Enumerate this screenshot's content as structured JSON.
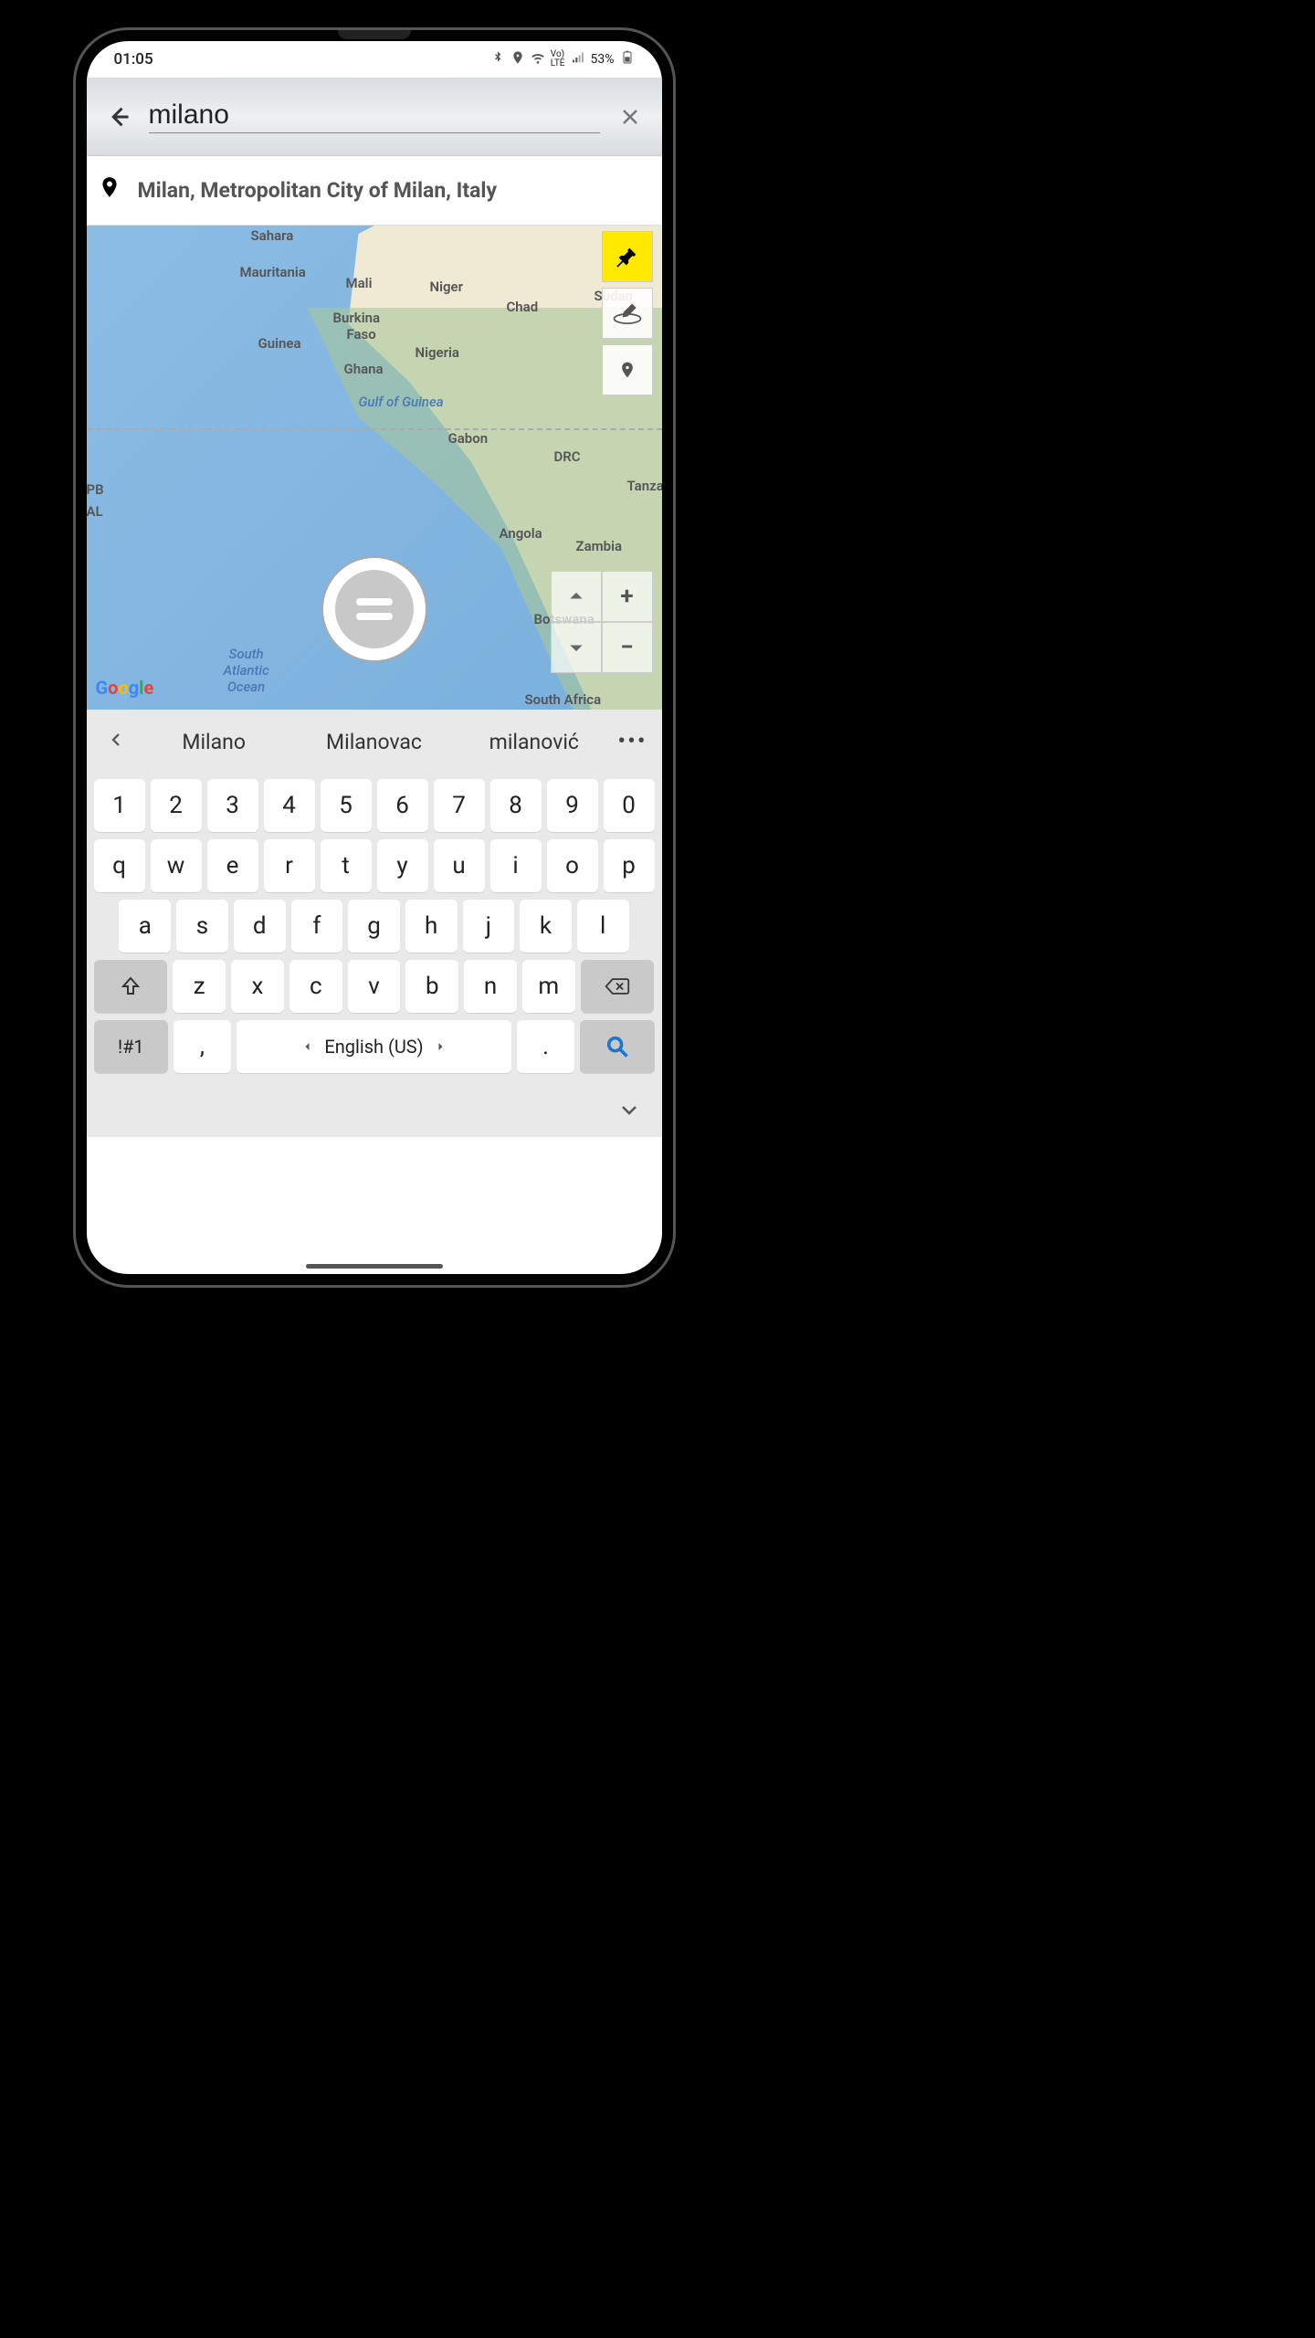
{
  "statusbar": {
    "time": "01:05",
    "battery": "53%"
  },
  "search": {
    "value": "milano"
  },
  "suggestion": {
    "text": "Milan, Metropolitan City of Milan, Italy"
  },
  "map": {
    "labels": {
      "sahara": "Sahara",
      "mauritania": "Mauritania",
      "mali": "Mali",
      "niger": "Niger",
      "chad": "Chad",
      "sudan": "Sudan",
      "burkina": "Burkina",
      "faso": "Faso",
      "guinea": "Guinea",
      "nigeria": "Nigeria",
      "ghana": "Ghana",
      "gulf": "Gulf of Guinea",
      "gabon": "Gabon",
      "drc": "DRC",
      "tanza": "Tanza",
      "angola": "Angola",
      "zambia": "Zambia",
      "botswana": "Botswana",
      "southafrica": "South Africa",
      "southatlantic": "South\nAtlantic\nOcean",
      "pb": "PB",
      "al": "AL"
    }
  },
  "kb_suggestions": {
    "s1": "Milano",
    "s2": "Milanovac",
    "s3": "milanović"
  },
  "keyboard": {
    "row1": [
      "1",
      "2",
      "3",
      "4",
      "5",
      "6",
      "7",
      "8",
      "9",
      "0"
    ],
    "row2": [
      "q",
      "w",
      "e",
      "r",
      "t",
      "y",
      "u",
      "i",
      "o",
      "p"
    ],
    "row3": [
      "a",
      "s",
      "d",
      "f",
      "g",
      "h",
      "j",
      "k",
      "l"
    ],
    "row4": [
      "z",
      "x",
      "c",
      "v",
      "b",
      "n",
      "m"
    ],
    "sym": "!#1",
    "comma": ",",
    "space": "English (US)",
    "period": "."
  }
}
